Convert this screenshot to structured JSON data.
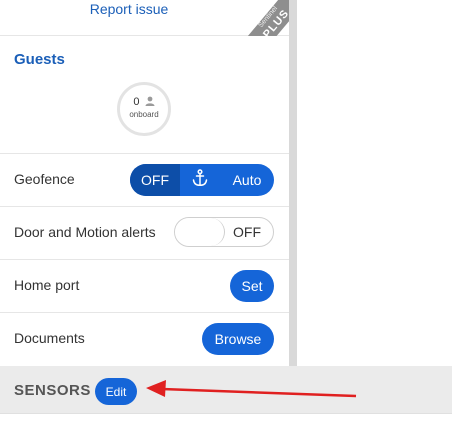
{
  "report": {
    "link_label": "Report issue"
  },
  "plus_badge": {
    "small_text": "Sentinel",
    "label": "PLUS"
  },
  "guests": {
    "title": "Guests",
    "count": "0",
    "count_label": "onboard"
  },
  "geofence": {
    "label": "Geofence",
    "off_label": "OFF",
    "anchor_icon": "anchor-icon",
    "auto_label": "Auto",
    "selected": "OFF"
  },
  "door_motion": {
    "label": "Door and Motion alerts",
    "state_label": "OFF"
  },
  "home_port": {
    "label": "Home port",
    "button_label": "Set"
  },
  "documents": {
    "label": "Documents",
    "button_label": "Browse"
  },
  "sensors": {
    "label": "SENSORS",
    "edit_label": "Edit"
  },
  "colors": {
    "accent": "#1565d8",
    "accent_dark": "#0d4ea8",
    "link": "#1b5fb8",
    "annotation_arrow": "#e02020"
  }
}
